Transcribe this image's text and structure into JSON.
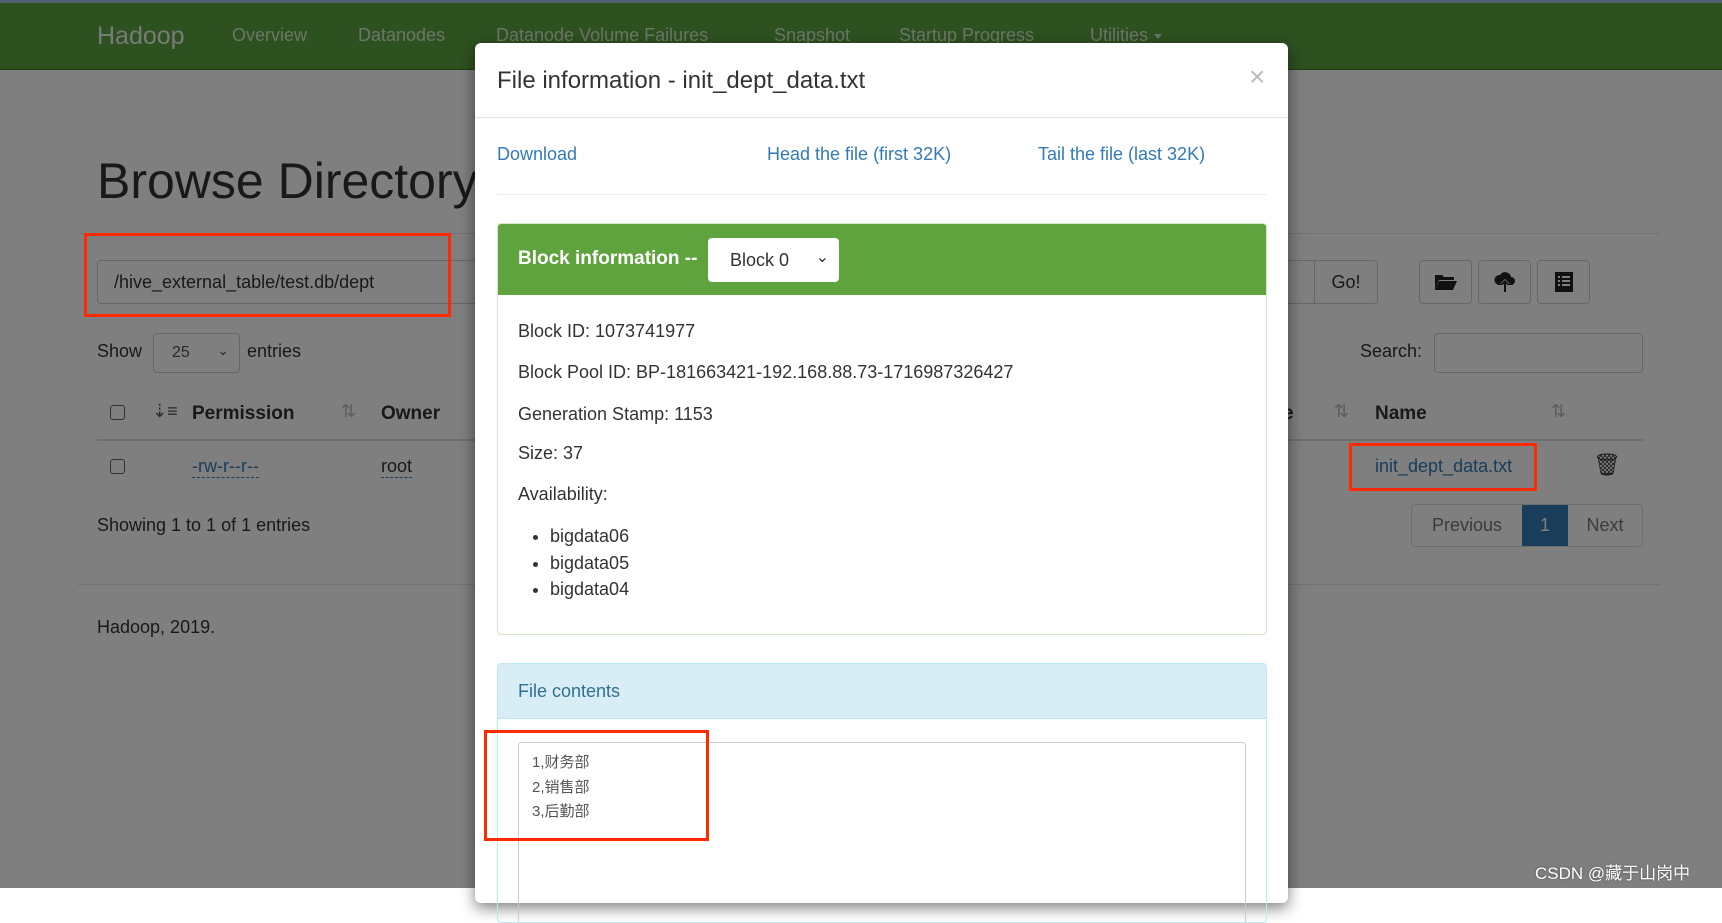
{
  "navbar": {
    "brand": "Hadoop",
    "items": [
      "Overview",
      "Datanodes",
      "Datanode Volume Failures",
      "Snapshot",
      "Startup Progress",
      "Utilities"
    ]
  },
  "page": {
    "title": "Browse Directory",
    "path_value": "/hive_external_table/test.db/dept",
    "go_label": "Go!",
    "show_label": "Show",
    "entries_value": "25",
    "entries_label": "entries",
    "search_label": "Search:",
    "search_value": "",
    "columns": [
      "Permission",
      "Owner",
      "Name"
    ],
    "partial_column_tail": "e",
    "row": {
      "permission": "-rw-r--r--",
      "owner": "root",
      "name": "init_dept_data.txt"
    },
    "showing": "Showing 1 to 1 of 1 entries",
    "pagination": {
      "previous": "Previous",
      "current": "1",
      "next": "Next"
    },
    "footer": "Hadoop, 2019."
  },
  "modal": {
    "title": "File information - init_dept_data.txt",
    "close": "×",
    "links": {
      "download": "Download",
      "head": "Head the file (first 32K)",
      "tail": "Tail the file (last 32K)"
    },
    "block_panel": {
      "title": "Block information --",
      "selected_block": "Block 0",
      "block_id": "Block ID: 1073741977",
      "block_pool_id": "Block Pool ID: BP-181663421-192.168.88.73-1716987326427",
      "generation_stamp": "Generation Stamp: 1153",
      "size": "Size: 37",
      "availability_label": "Availability:",
      "availability": [
        "bigdata06",
        "bigdata05",
        "bigdata04"
      ]
    },
    "contents_panel": {
      "title": "File contents",
      "lines": [
        "1,财务部",
        "2,销售部",
        "3,后勤部"
      ]
    }
  },
  "watermark": "CSDN @藏于山岗中",
  "colors": {
    "navbar": "#5ca240",
    "panel_success": "#5fa33e",
    "panel_info_bg": "#d9edf7",
    "link": "#337ab7",
    "active_page": "#337ab7",
    "annotation": "#ff2a00"
  }
}
